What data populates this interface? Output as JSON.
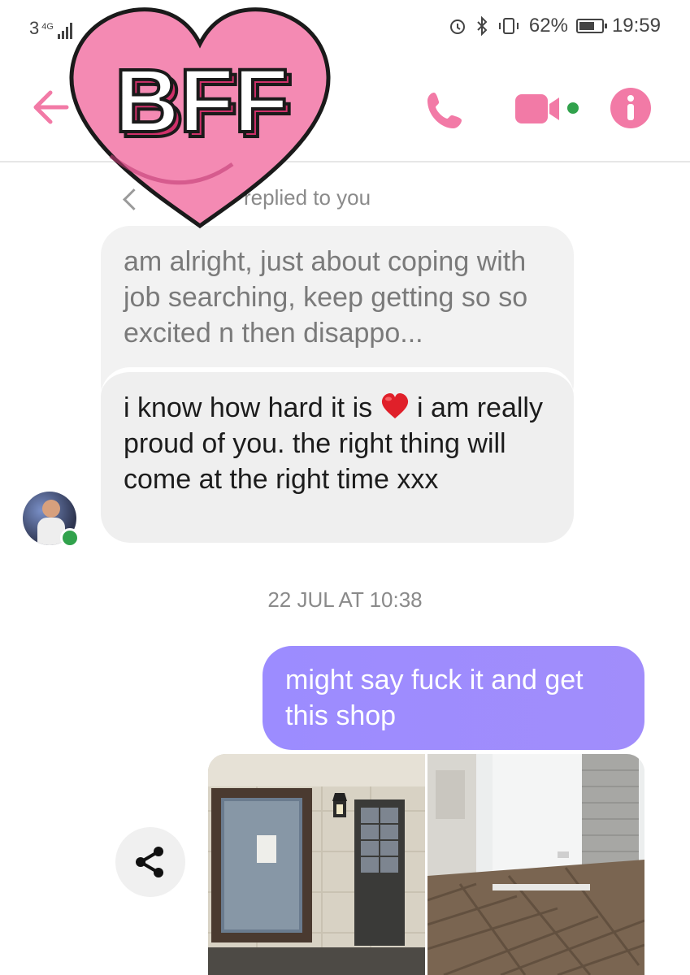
{
  "status_bar": {
    "carrier": "3",
    "network": "4G",
    "battery_percent": "62%",
    "time": "19:59"
  },
  "header": {
    "sticker_text": "BFF",
    "icons": [
      "back-arrow-icon",
      "phone-icon",
      "video-camera-icon",
      "info-icon"
    ],
    "accent_color": "#f27aa6",
    "online_color": "#31a24c"
  },
  "conversation": {
    "reply_label": "replied to you",
    "quoted_message": "am alright, just about coping with job searching, keep getting so so excited n then disappo...",
    "received": {
      "text_before_emoji": "i know how hard it is",
      "emoji": "red-heart",
      "text_after_emoji": "i am really proud of you. the right thing will come at the right time xxx"
    },
    "timestamp": "22 JUL AT 10:38",
    "sent_message": "might say fuck it and get this shop",
    "sent_bubble_color": "#a08cfc"
  }
}
